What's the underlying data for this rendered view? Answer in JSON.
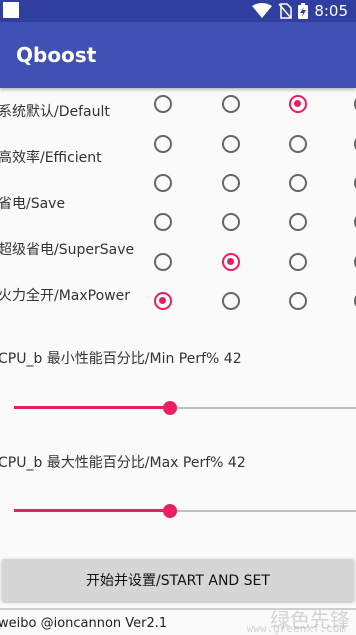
{
  "status_bar": {
    "time": "8:05",
    "icons": [
      "wifi-icon",
      "no-sim-icon",
      "battery-icon"
    ]
  },
  "app_bar": {
    "title": "Qboost"
  },
  "modes": [
    {
      "label": "系统默认/Default"
    },
    {
      "label": "高效率/Efficient"
    },
    {
      "label": "省电/Save"
    },
    {
      "label": "超级省电/SuperSave"
    },
    {
      "label": "火力全开/MaxPower"
    }
  ],
  "radio_columns": 4,
  "selected": [
    {
      "row": 0,
      "col": 2
    },
    {
      "row": 4,
      "col": 1
    },
    {
      "row": 5,
      "col": 0
    }
  ],
  "sliders": [
    {
      "label": "CPU_b 最小性能百分比/Min Perf% 42",
      "value": 42
    },
    {
      "label": "CPU_b 最大性能百分比/Max Perf% 42",
      "value": 42
    }
  ],
  "start_button": {
    "label": "开始并设置/START AND SET"
  },
  "footer": {
    "text": "weibo @ioncannon Ver2.1"
  },
  "watermark": {
    "text": "绿色先锋",
    "url": "www.greenxf.com"
  },
  "colors": {
    "primary": "#3f51b5",
    "primary_dark": "#303f9f",
    "accent": "#e91e63"
  }
}
